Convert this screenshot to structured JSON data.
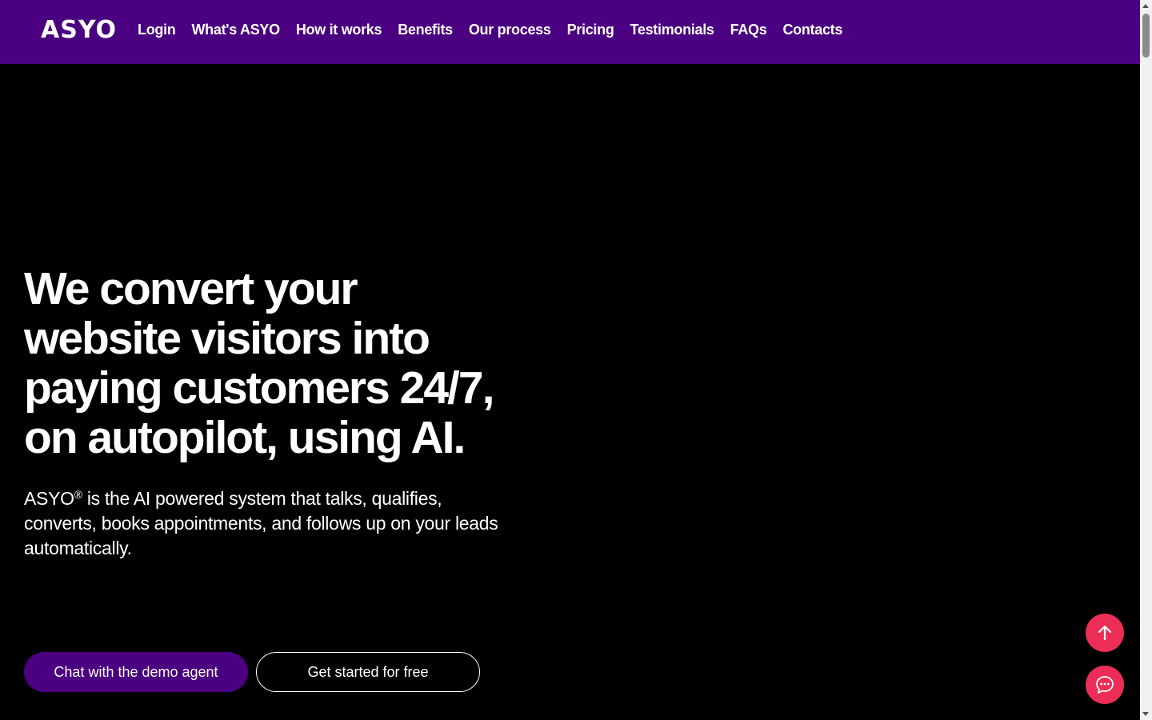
{
  "header": {
    "logo": "ASYO",
    "nav": [
      {
        "label": "Login"
      },
      {
        "label": "What's ASYO"
      },
      {
        "label": "How it works"
      },
      {
        "label": "Benefits"
      },
      {
        "label": "Our process"
      },
      {
        "label": "Pricing"
      },
      {
        "label": "Testimonials"
      },
      {
        "label": "FAQs"
      },
      {
        "label": "Contacts"
      }
    ]
  },
  "hero": {
    "title": "We convert your website visitors into paying customers 24/7, on autopilot, using AI.",
    "subtitle_brand": "ASYO",
    "subtitle_mark": "®",
    "subtitle_rest": " is the AI powered system that talks, qualifies, converts, books appointments, and follows up on your leads automatically.",
    "primary_button": "Chat with the demo agent",
    "secondary_button": "Get started for free"
  },
  "floating": {
    "scroll_top_icon": "arrow-up-icon",
    "chat_icon": "chat-bubble-icon"
  },
  "colors": {
    "header_bg": "#4a0080",
    "page_bg": "#000000",
    "primary_button_bg": "#4a0080",
    "fab_bg": "#ec2e57"
  }
}
